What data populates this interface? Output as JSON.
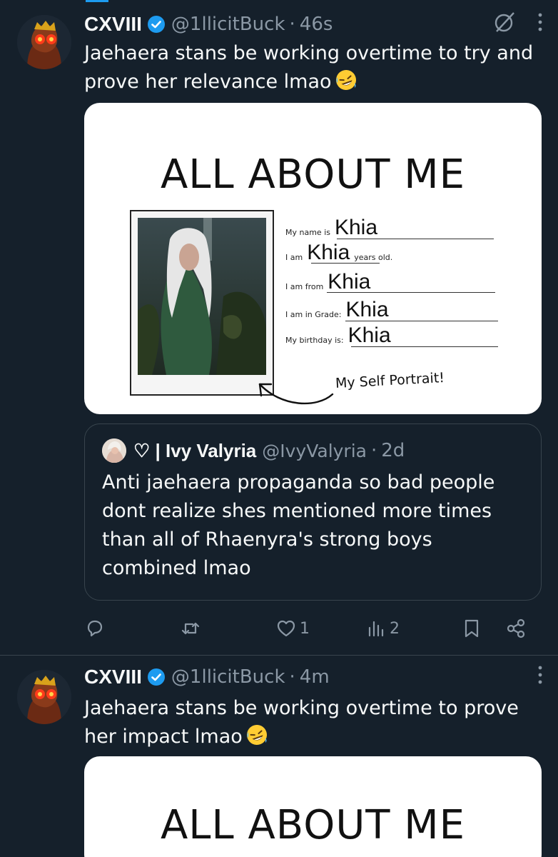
{
  "tweets": [
    {
      "name": "CXVIII",
      "handle": "@1llicitBuck",
      "time": "46s",
      "text": "Jaehaera stans be working overtime to try and prove her relevance lmao",
      "media": {
        "title": "ALL ABOUT ME",
        "fields": [
          {
            "label": "My name is",
            "value": "Khia"
          },
          {
            "label": "I am",
            "value": "Khia",
            "suffix": "years old."
          },
          {
            "label": "I am from",
            "value": "Khia"
          },
          {
            "label": "I am in Grade:",
            "value": "Khia"
          },
          {
            "label": "My birthday is:",
            "value": "Khia"
          }
        ],
        "caption": "My Self Portrait!"
      },
      "quote": {
        "name": "♡ | Ivy Valyria",
        "handle": "@IvyValyria",
        "time": "2d",
        "text": "Anti jaehaera propaganda so bad people dont realize shes mentioned more times than all of Rhaenyra's strong boys combined lmao"
      },
      "actions": {
        "reply_count": "",
        "retweet_count": "",
        "like_count": "1",
        "views_count": "2"
      }
    },
    {
      "name": "CXVIII",
      "handle": "@1llicitBuck",
      "time": "4m",
      "text": "Jaehaera stans be working overtime to prove her impact lmao",
      "media": {
        "title": "ALL ABOUT ME"
      }
    }
  ],
  "icons": {
    "verified": "verified-badge-icon",
    "grok": "slash-circle-icon",
    "more": "more-vertical-icon",
    "emoji": "rolling-laughing-emoji",
    "reply": "reply-icon",
    "retweet": "retweet-icon",
    "like": "heart-icon",
    "views": "views-icon",
    "bookmark": "bookmark-icon",
    "share": "share-icon"
  },
  "colors": {
    "background": "#15202b",
    "text": "#f7f9f9",
    "secondary": "#8b98a5",
    "accent": "#1d9bf0",
    "border": "#38444d"
  }
}
